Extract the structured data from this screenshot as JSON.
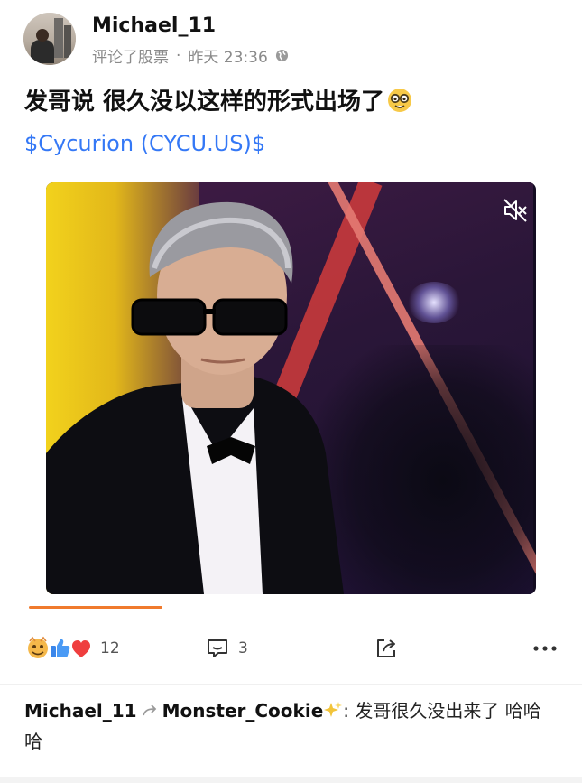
{
  "post": {
    "username": "Michael_11",
    "action": "评论了股票",
    "separator": "·",
    "time": "昨天 23:36",
    "text": "发哥说 很久没以这样的形式出场了",
    "ticker": "$Cycurion (CYCU.US)$"
  },
  "video": {
    "progress": 0.26,
    "muted": true
  },
  "actions": {
    "reaction_count": "12",
    "comment_count": "3"
  },
  "comment": {
    "author": "Michael_11",
    "reply_to": "Monster_Cookie",
    "text": ": 发哥很久没出来了 哈哈哈"
  },
  "colors": {
    "link": "#3478f6",
    "progress": "#f07a2d"
  }
}
